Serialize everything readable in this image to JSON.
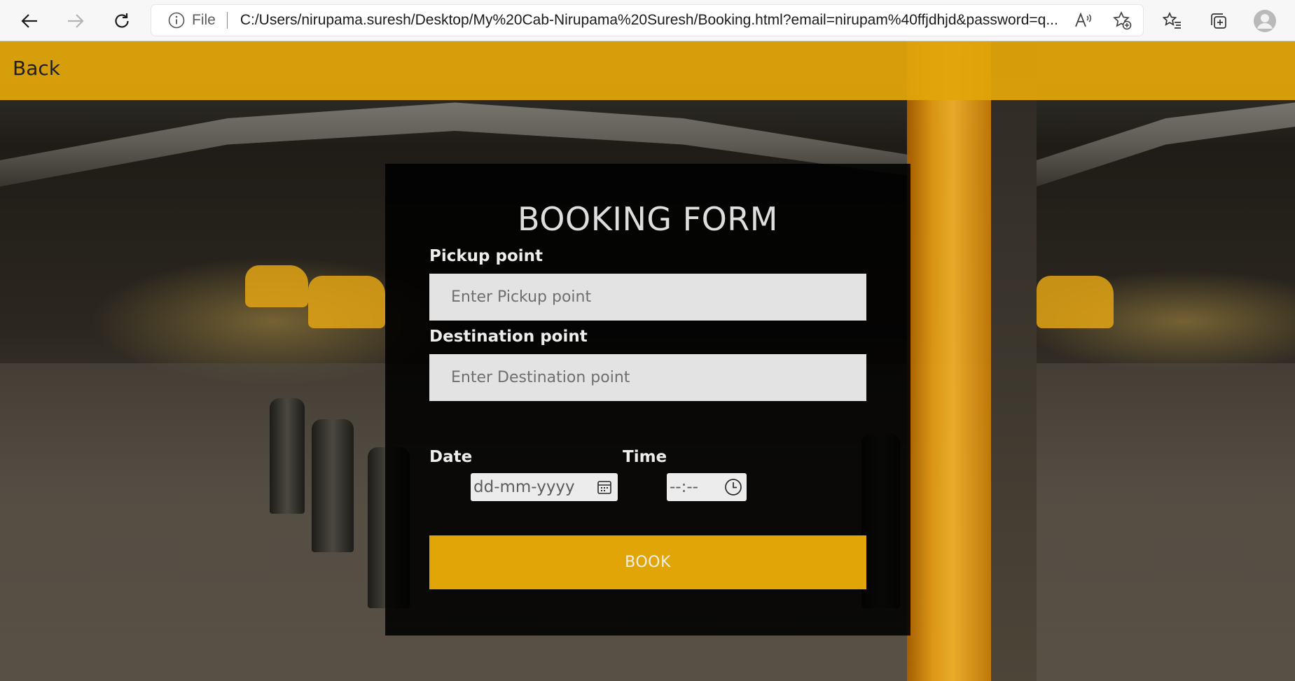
{
  "browser": {
    "address_prefix": "File",
    "url": "C:/Users/nirupama.suresh/Desktop/My%20Cab-Nirupama%20Suresh/Booking.html?email=nirupam%40ffjdhjd&password=q...",
    "icons": {
      "back": "arrow-left-icon",
      "forward": "arrow-right-icon",
      "refresh": "refresh-icon",
      "info": "info-icon",
      "read_aloud": "read-aloud-icon",
      "add_favorite": "star-plus-icon",
      "favorites": "favorites-list-icon",
      "collections": "collections-icon",
      "profile": "profile-avatar-icon"
    }
  },
  "header": {
    "back_label": "Back",
    "bar_color": "#e1a50a"
  },
  "form": {
    "title": "BOOKING FORM",
    "pickup": {
      "label": "Pickup point",
      "placeholder": "Enter Pickup point"
    },
    "destination": {
      "label": "Destination point",
      "placeholder": "Enter Destination point"
    },
    "date": {
      "label": "Date",
      "value": "dd-mm-yyyy",
      "icon": "calendar-icon"
    },
    "time": {
      "label": "Time",
      "value": "--:--",
      "icon": "clock-icon"
    },
    "submit_label": "BOOK",
    "button_color": "#e2a508"
  }
}
